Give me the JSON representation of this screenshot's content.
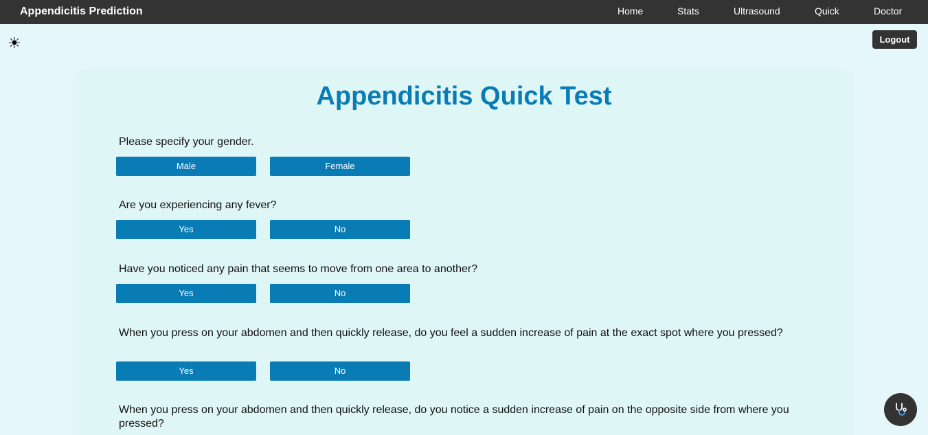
{
  "navbar": {
    "brand": "Appendicitis Prediction",
    "links": [
      "Home",
      "Stats",
      "Ultrasound",
      "Quick",
      "Doctor"
    ]
  },
  "theme_toggle": {
    "icon": "sun-icon",
    "glyph": "☀"
  },
  "logout_label": "Logout",
  "page_title": "Appendicitis Quick Test",
  "questions": [
    {
      "text": "Please specify your gender.",
      "options": [
        "Male",
        "Female"
      ]
    },
    {
      "text": "Are you experiencing any fever?",
      "options": [
        "Yes",
        "No"
      ]
    },
    {
      "text": "Have you noticed any pain that seems to move from one area to another?",
      "options": [
        "Yes",
        "No"
      ]
    },
    {
      "text": "When you press on your abdomen and then quickly release, do you feel a sudden increase of pain at the exact spot where you pressed?",
      "options": [
        "Yes",
        "No"
      ]
    },
    {
      "text": "When you press on your abdomen and then quickly release, do you notice a sudden increase of pain on the opposite side from where you pressed?"
    }
  ],
  "doctor_button": {
    "icon": "stethoscope-icon"
  },
  "colors": {
    "accent": "#0a7cb5",
    "navbar": "#333333",
    "background": "#e6f7fc",
    "card": "#dff6f7"
  }
}
